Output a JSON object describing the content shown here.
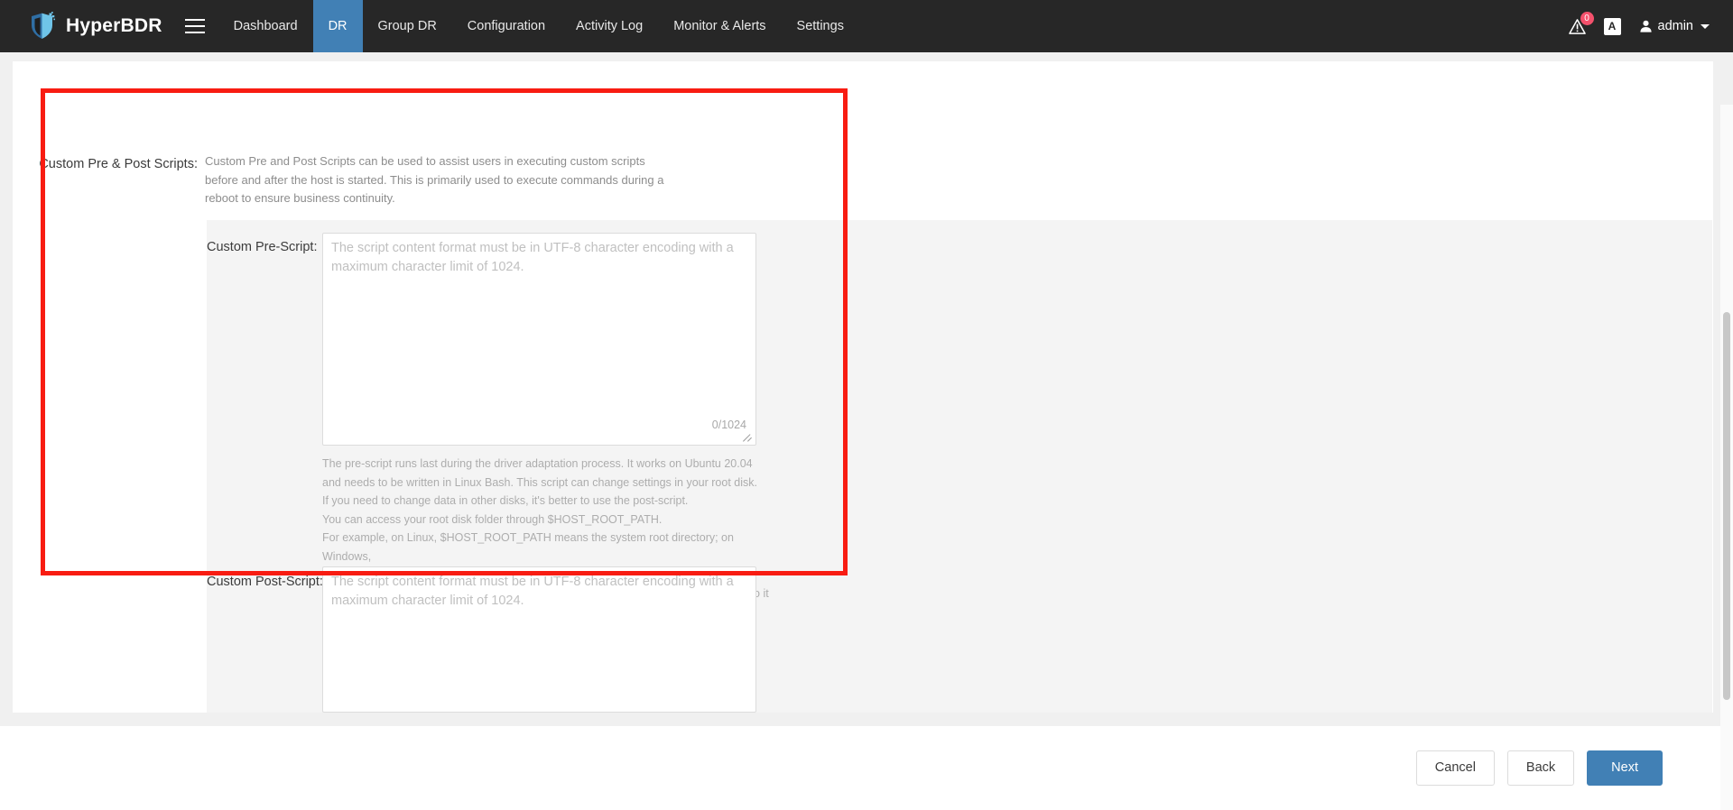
{
  "header": {
    "brand": "HyperBDR",
    "logo_icon": "shield-logo-icon",
    "menu_icon": "hamburger-menu-icon",
    "nav_items": [
      {
        "label": "Dashboard",
        "active": false
      },
      {
        "label": "DR",
        "active": true
      },
      {
        "label": "Group DR",
        "active": false
      },
      {
        "label": "Configuration",
        "active": false
      },
      {
        "label": "Activity Log",
        "active": false
      },
      {
        "label": "Monitor & Alerts",
        "active": false
      },
      {
        "label": "Settings",
        "active": false
      }
    ],
    "alerts": {
      "icon": "warning-alert-icon",
      "count": "0"
    },
    "language": {
      "icon": "language-switch-icon",
      "glyph": "A"
    },
    "user": {
      "icon": "user-avatar-icon",
      "name": "admin",
      "caret": "chevron-down-icon"
    }
  },
  "form": {
    "section_label": "Custom Pre & Post Scripts:",
    "section_description": "Custom Pre and Post Scripts can be used to assist users in executing custom scripts before and after the host is started. This is primarily used to execute commands during a reboot to ensure business continuity.",
    "pre_script": {
      "label": "Custom Pre-Script:",
      "value": "",
      "placeholder": "The script content format must be in UTF-8 character encoding with a maximum character limit of 1024.",
      "counter": "0/1024",
      "help": "The pre-script runs last during the driver adaptation process. It works on Ubuntu 20.04\nand needs to be written in Linux Bash. This script can change settings in your root disk.\nIf you need to change data in other disks, it's better to use the post-script.\nYou can access your root disk folder through $HOST_ROOT_PATH.\nFor example, on Linux, $HOST_ROOT_PATH means the system root directory; on Windows,\nit's the C drive.\nFor example, if you want to modify a program configuration file in CentOS 7, you can do it\nlike this: sed -i 's/old_text/new_text/g' $HOST_ROOT_PATH/path/to/config/file"
    },
    "post_script": {
      "label": "Custom Post-Script:",
      "value": "",
      "placeholder": "The script content format must be in UTF-8 character encoding with a maximum character limit of 1024."
    }
  },
  "footer": {
    "cancel_label": "Cancel",
    "back_label": "Back",
    "next_label": "Next"
  },
  "colors": {
    "accent": "#4180b5",
    "header_bg": "#272727",
    "annotation": "#f81c12",
    "badge": "#f4516c"
  }
}
